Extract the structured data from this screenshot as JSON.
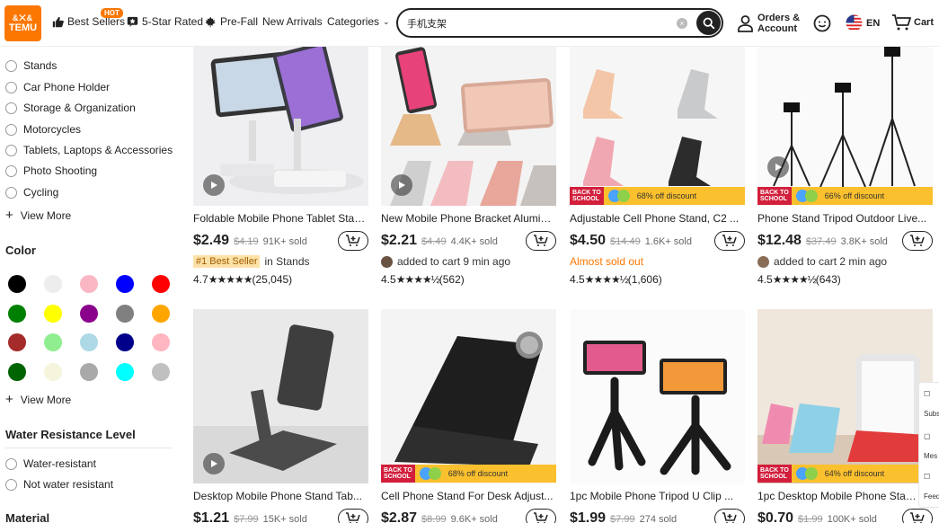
{
  "header": {
    "logo_text": "TEMU",
    "logo_icon_text": "&⨉&",
    "nav": [
      {
        "label": "Best Sellers",
        "badge": "HOT"
      },
      {
        "label": "5-Star Rated"
      },
      {
        "label": "Pre-Fall"
      },
      {
        "label": "New Arrivals"
      },
      {
        "label": "Categories"
      }
    ],
    "search": {
      "value": "手机支架",
      "placeholder": ""
    },
    "orders_line1": "Orders &",
    "orders_line2": "Account",
    "lang": "EN",
    "cart": "Cart"
  },
  "sidebar": {
    "categories": [
      "Stands",
      "Car Phone Holder",
      "Storage & Organization",
      "Motorcycles",
      "Tablets, Laptops & Accessories",
      "Photo Shooting",
      "Cycling"
    ],
    "view_more": "View More",
    "color_title": "Color",
    "colors": [
      "#000000",
      "#ededed",
      "#f9b7c4",
      "#0000ff",
      "#ff0000",
      "#008000",
      "#ffff00",
      "#8b008b",
      "#808080",
      "#ffa500",
      "#a52a2a",
      "#90ee90",
      "#add8e6",
      "#00008b",
      "#ffb6c1",
      "#006400",
      "#f5f5dc",
      "#a9a9a9",
      "#00ffff",
      "#c0c0c0"
    ],
    "color_view_more": "View More",
    "water_title": "Water Resistance Level",
    "water_options": [
      "Water-resistant",
      "Not water resistant"
    ],
    "material_title": "Material"
  },
  "products": [
    {
      "title": "Foldable Mobile Phone Tablet Stand...",
      "price": "$2.49",
      "orig": "$4.19",
      "sold": "91K+ sold",
      "tag_badge": "#1 Best Seller",
      "tag_text": "in Stands",
      "rating": "4.7",
      "stars": "★★★★★",
      "reviews": "(25,045)"
    },
    {
      "title": "New Mobile Phone Bracket Aluminum...",
      "price": "$2.21",
      "orig": "$4.49",
      "sold": "4.4K+ sold",
      "tag_text": "added to cart 9 min ago",
      "rating": "4.5",
      "stars": "★★★★½",
      "reviews": "(562)"
    },
    {
      "title": "Adjustable Cell Phone Stand, C2 ...",
      "price": "$4.50",
      "orig": "$14.49",
      "sold": "1.6K+ sold",
      "tag_text": "Almost sold out",
      "rating": "4.5",
      "stars": "★★★★½",
      "reviews": "(1,606)",
      "banner": "68% off discount"
    },
    {
      "title": "Phone Stand Tripod Outdoor Live...",
      "price": "$12.48",
      "orig": "$37.49",
      "sold": "3.8K+ sold",
      "tag_text": "added to cart 2 min ago",
      "rating": "4.5",
      "stars": "★★★★½",
      "reviews": "(643)",
      "banner": "66% off discount"
    },
    {
      "title": "Desktop Mobile Phone Stand Tab...",
      "price": "$1.21",
      "orig": "$7.99",
      "sold": "15K+ sold"
    },
    {
      "title": "Cell Phone Stand For Desk Adjust...",
      "price": "$2.87",
      "orig": "$8.99",
      "sold": "9.6K+ sold",
      "banner": "68% off discount"
    },
    {
      "title": "1pc Mobile Phone Tripod U Clip ...",
      "price": "$1.99",
      "orig": "$7.99",
      "sold": "274 sold"
    },
    {
      "title": "1pc Desktop Mobile Phone Stand...",
      "price": "$0.70",
      "orig": "$1.99",
      "sold": "100K+ sold",
      "banner": "64% off discount"
    }
  ],
  "banner_school": [
    "BACK TO",
    "SCHOOL"
  ],
  "side_float": [
    "Subs",
    "Mes",
    "Feed"
  ]
}
